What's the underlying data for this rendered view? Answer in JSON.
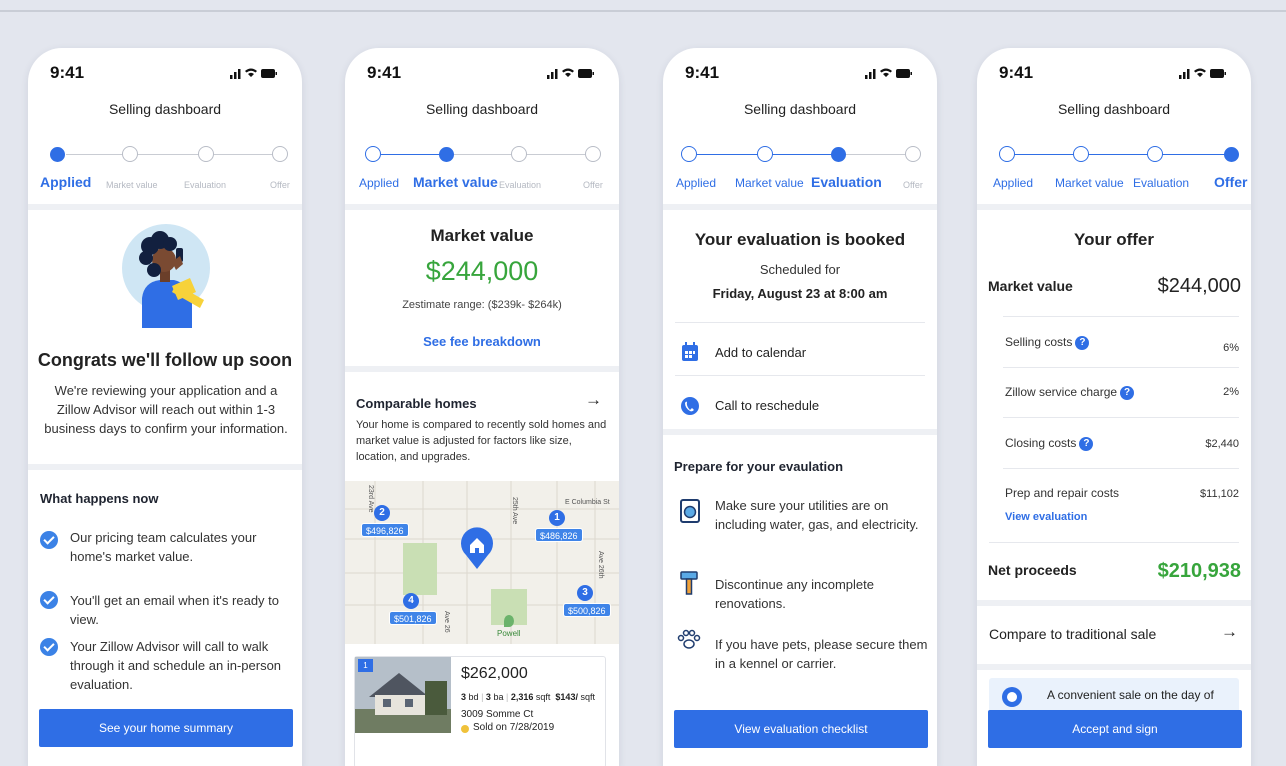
{
  "common": {
    "time": "9:41",
    "dashboard_title": "Selling dashboard",
    "steps": [
      "Applied",
      "Market value",
      "Evaluation",
      "Offer"
    ]
  },
  "screen1": {
    "headline": "Congrats we'll follow up soon",
    "message": "We're reviewing your application and a Zillow Advisor will reach out within 1-3 business days to confirm your information.",
    "what_happens_title": "What happens now",
    "items": [
      "Our pricing team calculates your home's market value.",
      "You'll get an email when it's ready to view.",
      "Your Zillow Advisor will call to walk through it and schedule an in-person evaluation."
    ],
    "button": "See your home summary"
  },
  "screen2": {
    "title": "Market value",
    "value": "$244,000",
    "range": "Zestimate range: ($239k- $264k)",
    "fee_link": "See fee breakdown",
    "comparable_title": "Comparable homes",
    "comparable_text": "Your home is compared to recently sold homes and market value is adjusted for factors like size, location, and upgrades.",
    "map": {
      "street_labels": [
        "23rd Ave",
        "E Columbia St",
        "25th Ave",
        "Ave 26th",
        "Powell",
        "Ave 26"
      ],
      "pins": [
        {
          "num": "1",
          "price": "$486,826"
        },
        {
          "num": "2",
          "price": "$496,826"
        },
        {
          "num": "3",
          "price": "$500,826"
        },
        {
          "num": "4",
          "price": "$501,826"
        }
      ]
    },
    "card": {
      "index": "1",
      "price": "$262,000",
      "bd": "3",
      "bd_label": "bd",
      "ba": "3",
      "ba_label": "ba",
      "sqft": "2,316",
      "sqft_label": "sqft",
      "ppsf": "$143/",
      "ppsf_label": "sqft",
      "address": "3009 Somme Ct",
      "sold": "Sold on 7/28/2019"
    }
  },
  "screen3": {
    "title": "Your evaluation is booked",
    "scheduled_for": "Scheduled for",
    "date": "Friday, August 23 at 8:00 am",
    "actions": [
      "Add to calendar",
      "Call to reschedule"
    ],
    "prepare_title": "Prepare for your evaulation",
    "tips": [
      "Make sure your utilities are on including water, gas, and electricity.",
      "Discontinue any incomplete renovations.",
      "If you have pets, please secure them in a kennel or carrier."
    ],
    "button": "View evaluation checklist"
  },
  "screen4": {
    "title": "Your offer",
    "market_value_label": "Market value",
    "market_value": "$244,000",
    "costs": [
      {
        "label": "Selling costs",
        "value": "6%",
        "help": true
      },
      {
        "label": "Zillow service charge",
        "value": "2%",
        "help": true
      },
      {
        "label": "Closing costs",
        "value": "$2,440",
        "help": true
      },
      {
        "label": "Prep and repair costs",
        "value": "$11,102",
        "help": false
      }
    ],
    "help_glyph": "?",
    "view_evaluation": "View evaluation",
    "net_label": "Net proceeds",
    "net_value": "$210,938",
    "compare": "Compare to traditional sale",
    "promo": "A convenient sale on the day of",
    "button": "Accept and sign"
  },
  "arrow_glyph": "→",
  "colors": {
    "accent": "#2f6ee5",
    "green": "#37a53c",
    "background": "#e3e6ee"
  }
}
